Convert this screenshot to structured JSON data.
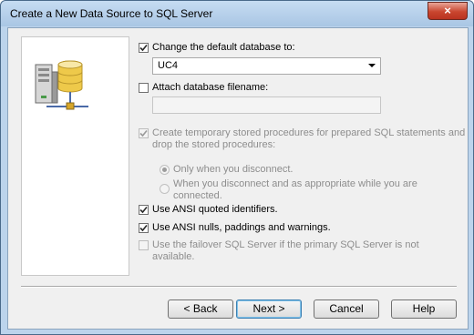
{
  "window": {
    "title": "Create a New Data Source to SQL Server",
    "close_glyph": "×"
  },
  "options": {
    "change_default_db": {
      "label": "Change the default database to:",
      "checked": true,
      "enabled": true
    },
    "database_combo": {
      "value": "UC4"
    },
    "attach_filename": {
      "label": "Attach database filename:",
      "checked": false,
      "enabled": true
    },
    "attach_field": {
      "value": ""
    },
    "temp_procs": {
      "label_line1": "Create temporary stored procedures for prepared SQL statements and",
      "label_line2": "drop the stored procedures:",
      "checked": true,
      "enabled": false
    },
    "radio_disconnect": {
      "label": "Only when you disconnect.",
      "selected": true,
      "enabled": false
    },
    "radio_appropriate": {
      "label_line1": "When you disconnect and as appropriate while you are",
      "label_line2": "connected.",
      "selected": false,
      "enabled": false
    },
    "ansi_quoted": {
      "label": "Use ANSI quoted identifiers.",
      "checked": true,
      "enabled": true
    },
    "ansi_nulls": {
      "label": "Use ANSI nulls, paddings and warnings.",
      "checked": true,
      "enabled": true
    },
    "failover": {
      "label_line1": "Use the failover SQL Server if the primary SQL Server is not",
      "label_line2": "available.",
      "checked": false,
      "enabled": false
    }
  },
  "buttons": {
    "back": "< Back",
    "next": "Next >",
    "cancel": "Cancel",
    "help": "Help"
  },
  "icons": {
    "side_art": "database-server-icon",
    "checkbox_mark": "check-icon",
    "dropdown": "chevron-down-icon"
  }
}
